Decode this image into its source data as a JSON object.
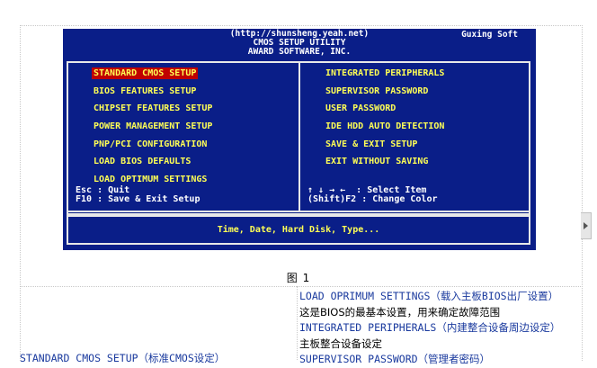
{
  "bios": {
    "header_lines": [
      "(http://shunsheng.yeah.net)",
      "CMOS SETUP UTILITY",
      "AWARD SOFTWARE, INC."
    ],
    "header_right": "Guxing Soft",
    "menu_left": [
      "STANDARD CMOS SETUP",
      "BIOS FEATURES SETUP",
      "CHIPSET FEATURES SETUP",
      "POWER MANAGEMENT SETUP",
      "PNP/PCI CONFIGURATION",
      "LOAD BIOS DEFAULTS",
      "LOAD OPTIMUM SETTINGS"
    ],
    "menu_right": [
      "INTEGRATED PERIPHERALS",
      "SUPERVISOR PASSWORD",
      "USER PASSWORD",
      "IDE HDD AUTO DETECTION",
      "SAVE & EXIT SETUP",
      "EXIT WITHOUT SAVING"
    ],
    "selected_index": 0,
    "keys": {
      "esc": "Esc : Quit",
      "f10": "F10 : Save & Exit Setup",
      "arrows": "↑ ↓ → ←  : Select Item",
      "f2": "(Shift)F2 : Change Color"
    },
    "status": "Time, Date, Hard Disk, Type..."
  },
  "caption": "图 1",
  "descriptions": [
    {
      "text": "LOAD OPRIMUM SETTINGS（载入主板BIOS出厂设置）",
      "color": "blue"
    },
    {
      "text": "这是BIOS的最基本设置，用来确定故障范围",
      "color": "black"
    },
    {
      "text": "INTEGRATED PERIPHERALS（内建整合设备周边设定）",
      "color": "blue"
    },
    {
      "text": "主板整合设备设定",
      "color": "black"
    },
    {
      "text": "SUPERVISOR PASSWORD（管理者密码）",
      "color": "blue"
    }
  ],
  "left_description": "STANDARD CMOS SETUP（标准CMOS设定）"
}
